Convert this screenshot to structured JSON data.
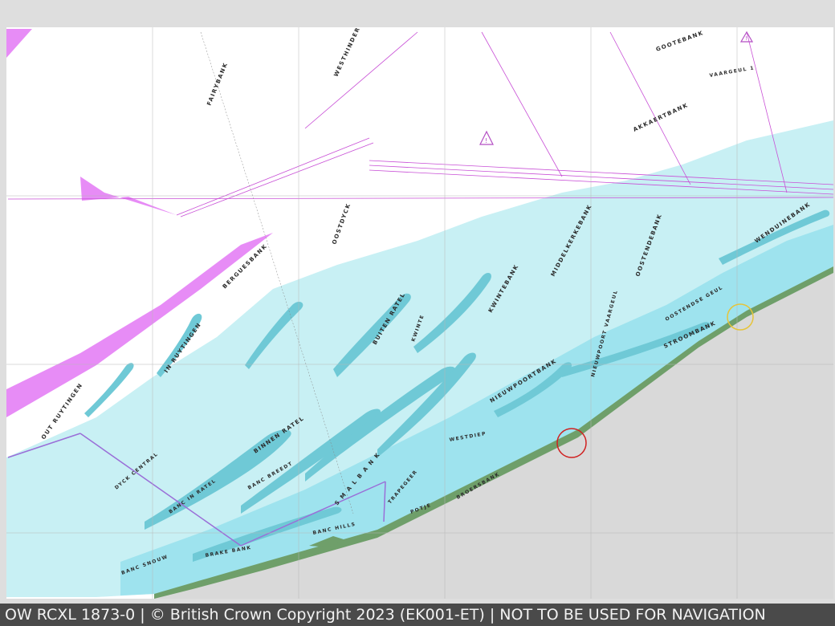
{
  "chart": {
    "colors": {
      "frame_background": "#dedede",
      "deep_water": "#ffffff",
      "shallow_light": "#c8f0f4",
      "shallow_mid": "#9ee3ee",
      "shallow_dark": "#6fc9d6",
      "drying": "#6f9f6a",
      "land": "#d9d9d9",
      "zone_magenta": "#e480f5",
      "route_magenta": "#c84fd6",
      "caption_bg": "#4a4a4a",
      "caption_text": "#f2f2f2"
    },
    "bank_labels": {
      "fairybank": "FAIRYBANK",
      "westhinder": "WESTHINDER",
      "gootebank": "GOOTEBANK",
      "akkaertbank": "AKKAERTBANK",
      "bergues_bank": "BERGUESBANK",
      "oostdyck": "OOSTDYCK",
      "buiten_ratel": "BUITEN RATEL",
      "kwintebank": "KWINTEBANK",
      "middelkerkebank": "MIDDELKERKEBANK",
      "oostendebank": "OOSTENDEBANK",
      "wenduinebank": "WENDUINEBANK",
      "stroombank": "STROOMBANK",
      "nieuwpoortbank": "NIEUWPOORTBANK",
      "in_ruytingen": "IN RUYTINGEN",
      "out_ruytingen": "OUT RUYTINGEN",
      "binnen_ratel": "BINNEN RATEL",
      "smal_bank": "S M A L   B A N K",
      "trapegeer": "TRAPEGEER",
      "banc_breedt": "BANC BREEDT",
      "banc_in_ratel": "BANC IN RATEL",
      "dyck_central": "DYCK CENTRAL",
      "broersbank": "BROERSBANK",
      "potje": "POTJE",
      "kwinte": "KWINTE",
      "westdiep": "WESTDIEP",
      "banc_snouw": "BANC SNOUW",
      "banc_hills": "BANC HILLS",
      "vaargeul": "VAARGEUL 1",
      "oostendse_geul": "OOSTENDSE GEUL",
      "nieuwpoort_vaargeul": "NIEUWPOORT VAARGEUL",
      "banc_smal": "BRAKE BANK"
    },
    "icons": [
      "caution-triangle-icon",
      "caution-triangle-icon",
      "harbour-circle-icon",
      "breakwater-icon"
    ]
  },
  "caption": {
    "text": "OW RCXL 1873-0 | © British Crown Copyright 2023 (EK001-ET) | NOT TO BE USED FOR NAVIGATION"
  }
}
